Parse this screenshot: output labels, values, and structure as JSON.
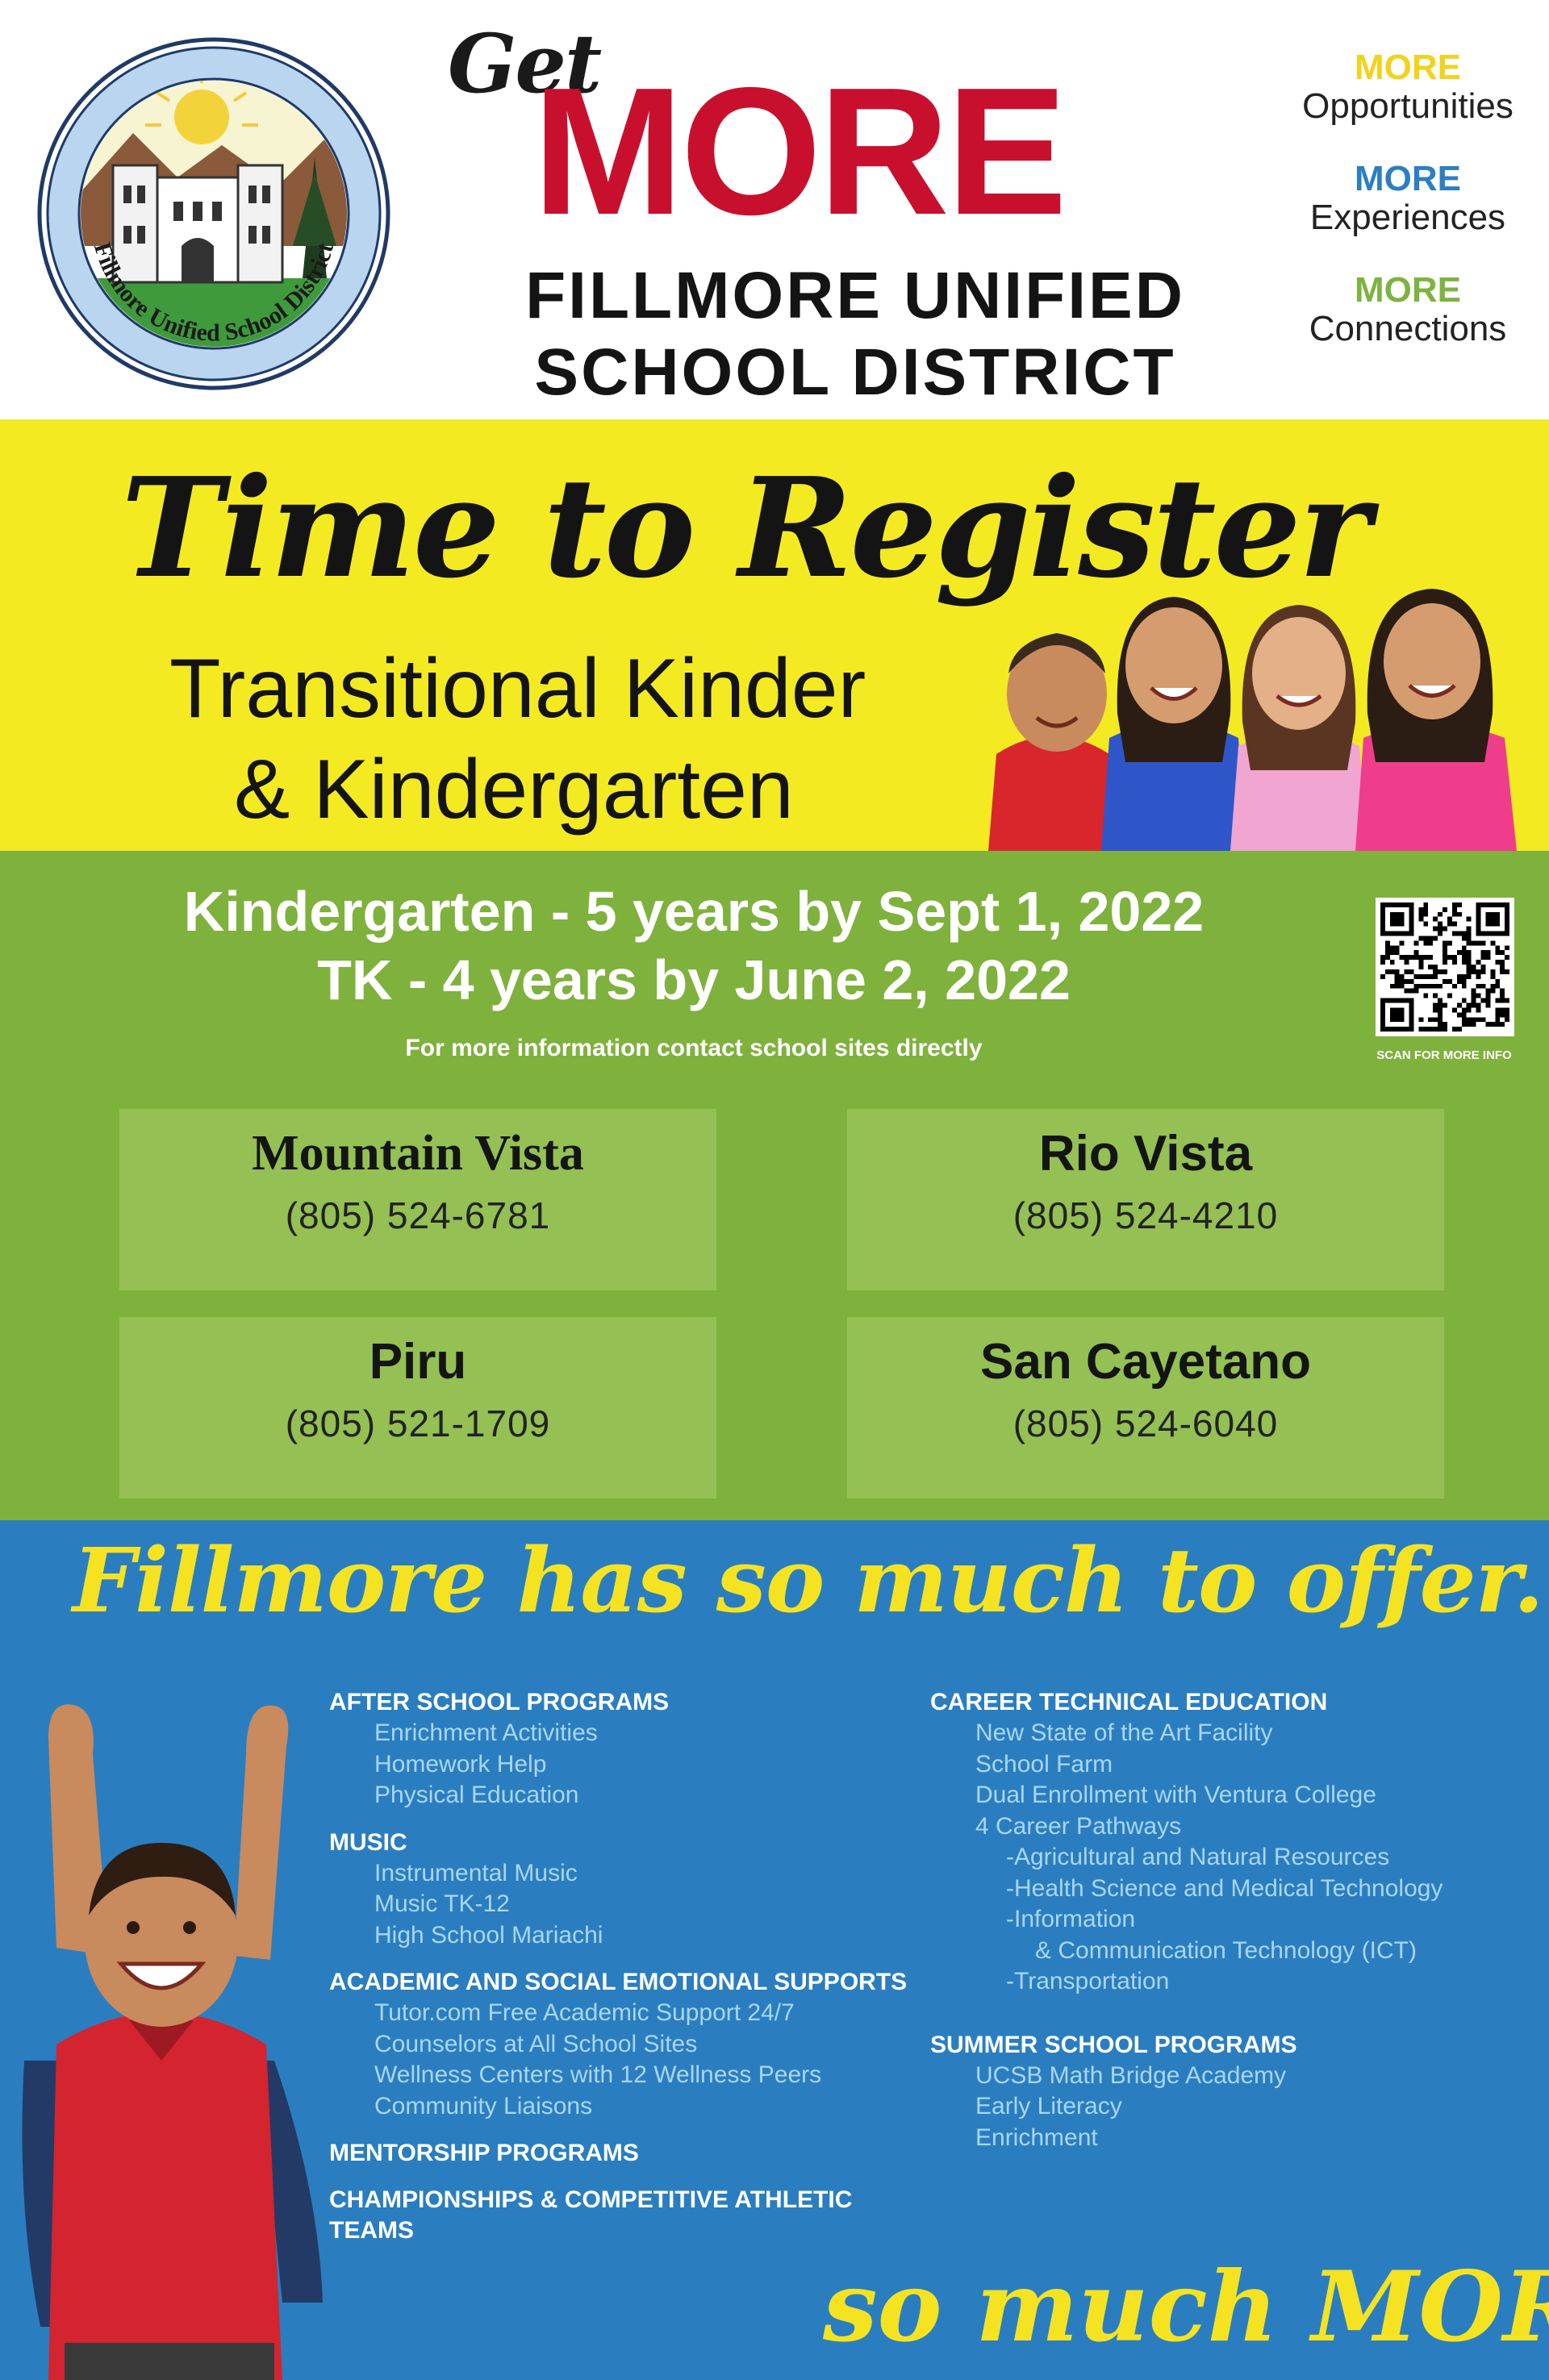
{
  "header": {
    "logo_ring_text": "Fillmore Unified School District",
    "get": "Get",
    "more": "MORE",
    "district_line1": "FILLMORE UNIFIED",
    "district_line2": "SCHOOL DISTRICT",
    "taglines": [
      {
        "more": "MORE",
        "word": "Opportunities",
        "color": "#f2d21c"
      },
      {
        "more": "MORE",
        "word": "Experiences",
        "color": "#2b7fc2"
      },
      {
        "more": "MORE",
        "word": "Connections",
        "color": "#7db340"
      }
    ]
  },
  "register": {
    "title": "Time to Register",
    "subtitle_line1": "Transitional Kinder",
    "subtitle_line2": "& Kindergarten"
  },
  "info": {
    "kinder_age": "Kindergarten - 5 years by Sept 1, 2022",
    "tk_age": "TK - 4 years by June 2, 2022",
    "contact_note": "For more information contact school sites directly",
    "qr_caption": "SCAN FOR MORE INFO",
    "schools": [
      {
        "name": "Mountain Vista",
        "phone": "(805) 524-6781"
      },
      {
        "name": "Rio Vista",
        "phone": "(805) 524-4210"
      },
      {
        "name": "Piru",
        "phone": "(805) 521-1709"
      },
      {
        "name": "San Cayetano",
        "phone": "(805) 524-6040"
      }
    ]
  },
  "offer": {
    "title": "Fillmore has so much to offer...",
    "left": {
      "after_school": "AFTER SCHOOL PROGRAMS",
      "after_school_items": [
        "Enrichment Activities",
        "Homework Help",
        "Physical Education"
      ],
      "music": "MUSIC",
      "music_items": [
        "Instrumental Music",
        "Music TK-12",
        "High School Mariachi"
      ],
      "academic": "ACADEMIC AND SOCIAL EMOTIONAL SUPPORTS",
      "academic_items": [
        "Tutor.com Free Academic Support 24/7",
        "Counselors at All School Sites",
        "Wellness Centers with 12 Wellness Peers",
        "Community Liaisons"
      ],
      "mentorship": "MENTORSHIP PROGRAMS",
      "athletics": "CHAMPIONSHIPS & COMPETITIVE ATHLETIC TEAMS"
    },
    "right": {
      "cte": "CAREER TECHNICAL EDUCATION",
      "cte_items": [
        "New State of the Art Facility",
        "School Farm",
        "Dual Enrollment with Ventura College",
        "4 Career Pathways"
      ],
      "pathways": [
        "-Agricultural and Natural Resources",
        "-Health Science and Medical Technology",
        "-Information"
      ],
      "pathway_continued": "& Communication Technology (ICT)",
      "pathway_last": "-Transportation",
      "summer": "SUMMER SCHOOL PROGRAMS",
      "summer_items": [
        "UCSB Math Bridge Academy",
        "Early Literacy",
        "Enrichment"
      ]
    },
    "closing": "so much MORE!"
  }
}
